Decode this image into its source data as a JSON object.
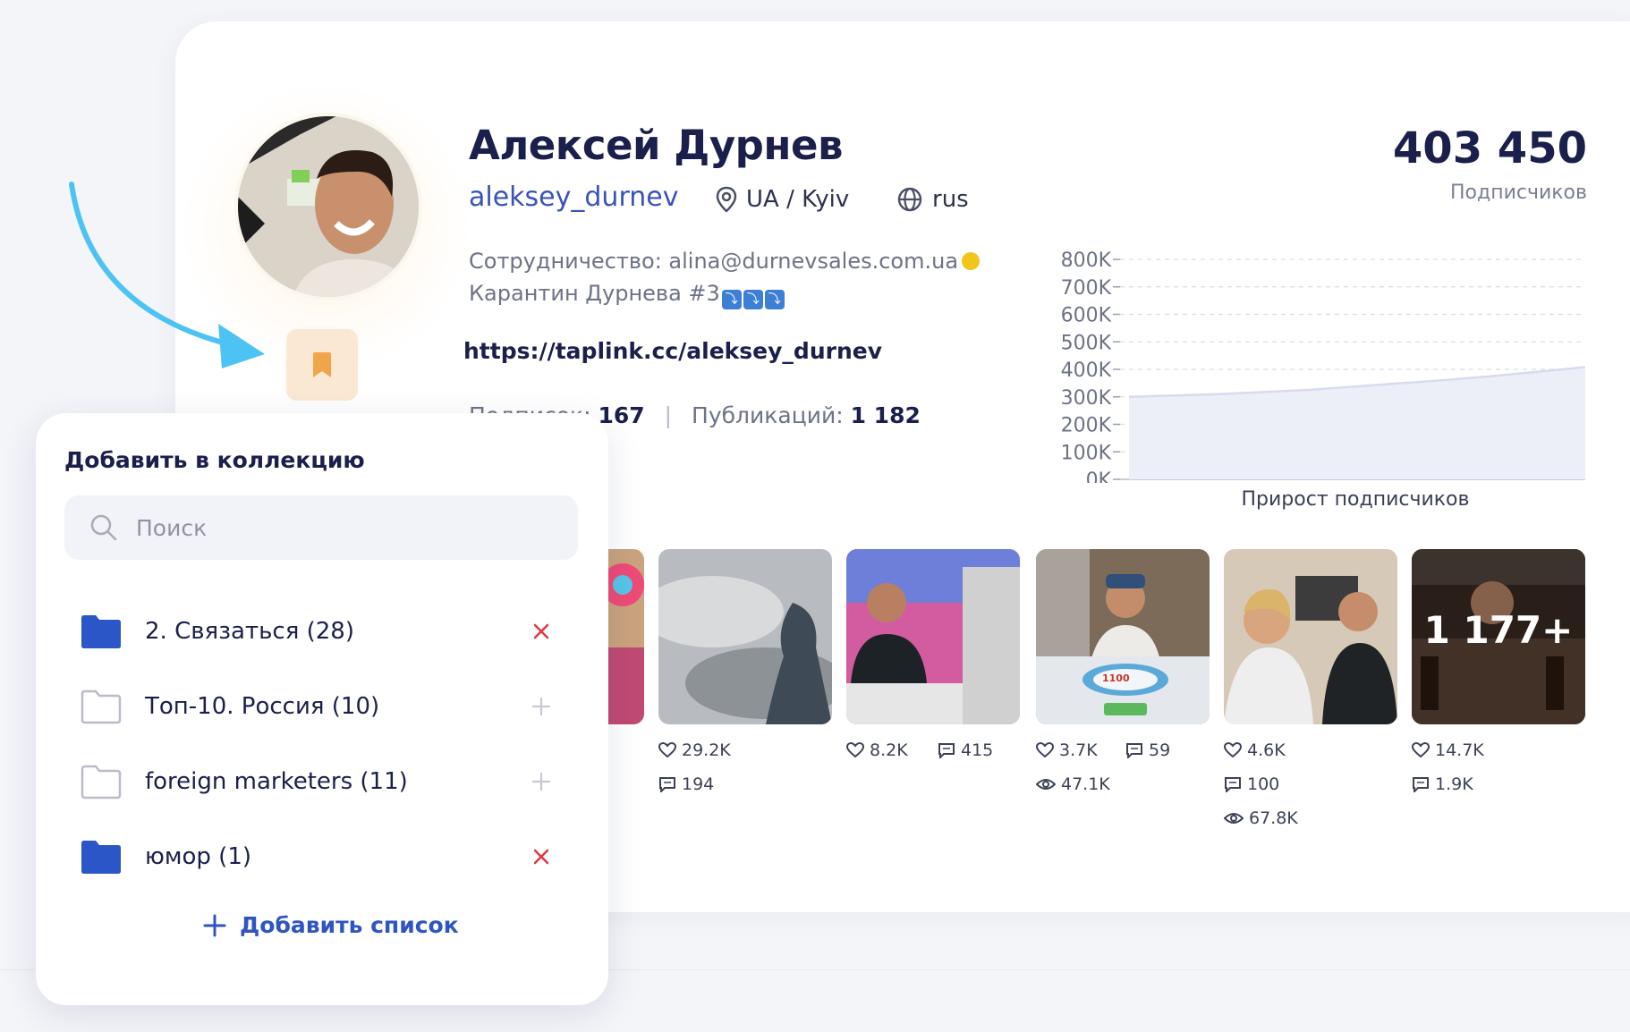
{
  "profile": {
    "name": "Алексей Дурнев",
    "username": "aleksey_durnev",
    "location": "UA / Kyiv",
    "language": "rus",
    "bio_line1": "Сотрудничество: alina@durnevsales.com.ua",
    "bio_line2": "Карантин Дурнева #3",
    "link": "https://taplink.cc/aleksey_durnev",
    "followings_label": "Подписок:",
    "followings_value": "167",
    "posts_label": "Публикаций:",
    "posts_value": "1 182",
    "subscribers_value": "403 450",
    "subscribers_label": "Подписчиков"
  },
  "chart_data": {
    "type": "area",
    "title": "Прирост подписчиков",
    "y_ticks": [
      "800K",
      "700K",
      "600K",
      "500K",
      "400K",
      "300K",
      "200K",
      "100K",
      "0K"
    ],
    "ylim": [
      0,
      800000
    ],
    "grid": true,
    "x": [
      0,
      1,
      2,
      3,
      4,
      5,
      6,
      7,
      8,
      9,
      10
    ],
    "values": [
      300000,
      305000,
      310000,
      318000,
      326000,
      338000,
      350000,
      362000,
      376000,
      392000,
      408000
    ]
  },
  "posts": [
    {
      "likes": "",
      "comments": "",
      "views": "",
      "overlay": ""
    },
    {
      "likes": "29.2K",
      "comments": "194",
      "views": "",
      "overlay": ""
    },
    {
      "likes": "8.2K",
      "comments": "415",
      "views": "",
      "overlay": ""
    },
    {
      "likes": "3.7K",
      "comments": "59",
      "views": "47.1K",
      "overlay": "1100"
    },
    {
      "likes": "4.6K",
      "comments": "100",
      "views": "67.8K",
      "overlay": ""
    },
    {
      "likes": "14.7K",
      "comments": "1.9K",
      "views": "",
      "overlay": "1 177+"
    }
  ],
  "popup": {
    "title": "Добавить в коллекцию",
    "search_placeholder": "Поиск",
    "collections": [
      {
        "label": "2. Связаться (28)",
        "selected": true
      },
      {
        "label": "Топ-10. Россия (10)",
        "selected": false
      },
      {
        "label": "foreign marketers (11)",
        "selected": false
      },
      {
        "label": "юмор (1)",
        "selected": true
      }
    ],
    "add_list_label": "Добавить список"
  },
  "colors": {
    "accent_blue": "#2f55c2",
    "folder_blue": "#2b56c8",
    "remove_red": "#e0393e",
    "bookmark_orange": "#efa64a",
    "arrow_cyan": "#4cc3f2"
  },
  "icons": {
    "location": "map-pin-icon",
    "language": "globe-icon",
    "bookmark": "bookmark-icon",
    "likes": "heart-icon",
    "comments": "comment-icon",
    "views": "eye-icon",
    "search": "search-icon",
    "folder": "folder-icon",
    "remove": "close-icon",
    "add": "plus-icon"
  }
}
